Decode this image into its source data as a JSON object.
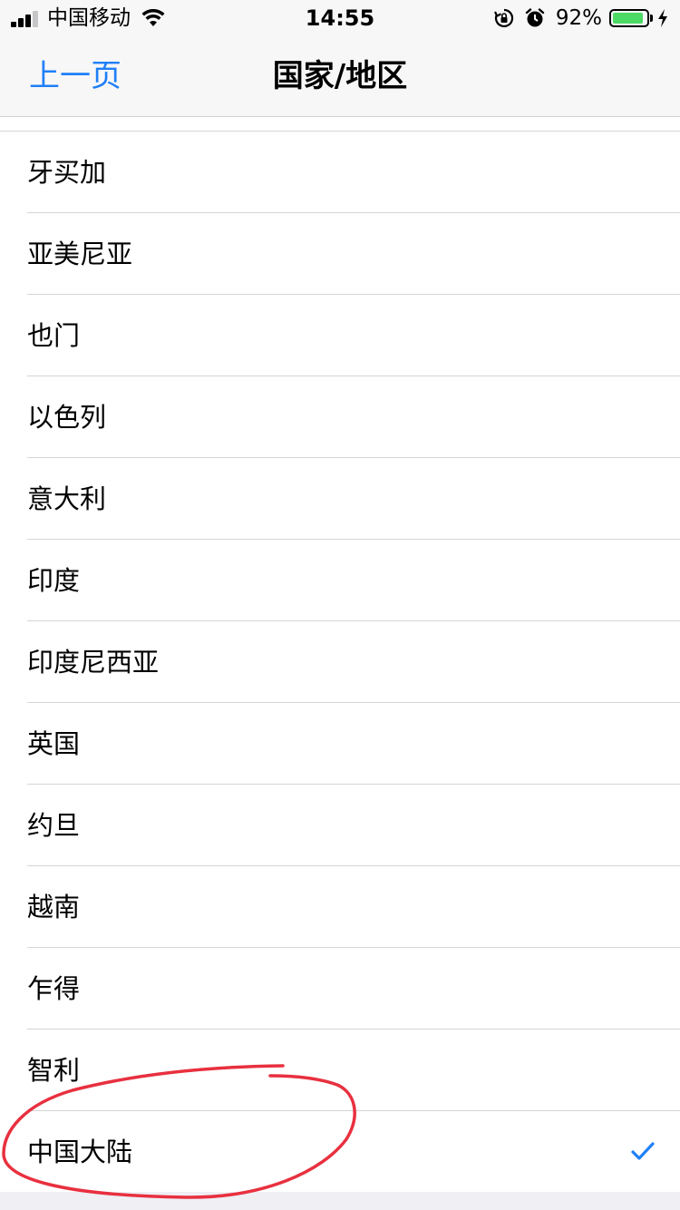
{
  "status_bar": {
    "carrier": "中国移动",
    "time": "14:55",
    "battery_percent": "92%",
    "battery_level": 0.92,
    "battery_color": "#4cd964",
    "icons": [
      "signal-icon",
      "wifi-icon",
      "orientation-lock-icon",
      "alarm-icon",
      "battery-icon",
      "charging-bolt-icon"
    ]
  },
  "nav": {
    "back_label": "上一页",
    "title": "国家/地区",
    "accent_color": "#1f7ff8"
  },
  "countries": [
    {
      "name": "牙买加",
      "selected": false
    },
    {
      "name": "亚美尼亚",
      "selected": false
    },
    {
      "name": "也门",
      "selected": false
    },
    {
      "name": "以色列",
      "selected": false
    },
    {
      "name": "意大利",
      "selected": false
    },
    {
      "name": "印度",
      "selected": false
    },
    {
      "name": "印度尼西亚",
      "selected": false
    },
    {
      "name": "英国",
      "selected": false
    },
    {
      "name": "约旦",
      "selected": false
    },
    {
      "name": "越南",
      "selected": false
    },
    {
      "name": "乍得",
      "selected": false
    },
    {
      "name": "智利",
      "selected": false
    },
    {
      "name": "中国大陆",
      "selected": true
    }
  ],
  "annotation": {
    "color": "#e8303f"
  }
}
